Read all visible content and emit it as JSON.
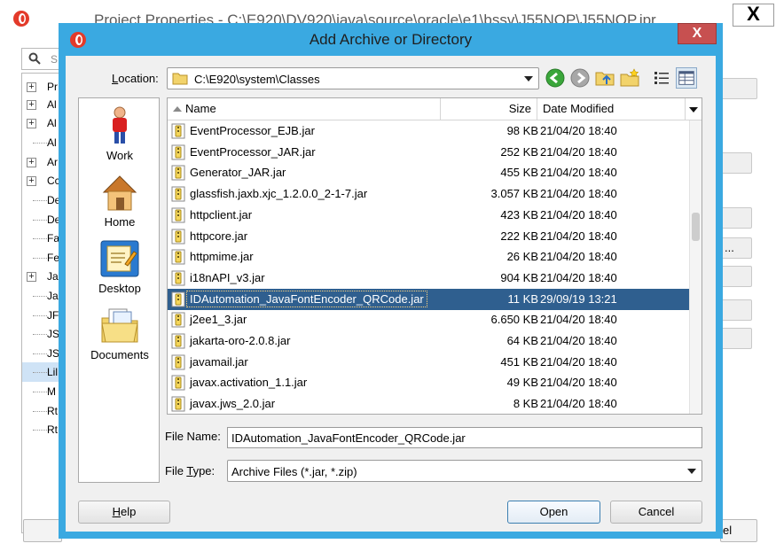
{
  "background_window": {
    "title": "Project Properties - C:\\E920\\DV920\\java\\source\\oracle\\e1\\bssv\\J55NOP\\J55NOP.jpr",
    "close_glyph": "X",
    "search_placeholder": "S",
    "tree_items": [
      "Pr",
      "Al",
      "Al",
      "Al",
      "Ar",
      "Cc",
      "De",
      "De",
      "Fa",
      "Fe",
      "Ja",
      "Ja",
      "JF",
      "JS",
      "JS",
      "Lil",
      "M",
      "Rt",
      "Rt"
    ],
    "browse_ellipsis": "...",
    "bottom_button_tail": "el"
  },
  "dialog": {
    "title": "Add Archive or Directory",
    "close_glyph": "X",
    "location": {
      "label_prefix": "L",
      "label_rest": "ocation:",
      "value": "C:\\E920\\system\\Classes"
    },
    "toolbar": {
      "back_icon": "back-icon",
      "forward_icon": "forward-icon",
      "up_folder_icon": "up-folder-icon",
      "new_folder_icon": "new-folder-icon",
      "list_view_icon": "list-view-icon",
      "details_view_icon": "details-view-icon"
    },
    "places": [
      {
        "label": "Work",
        "icon": "work-person-icon"
      },
      {
        "label": "Home",
        "icon": "home-icon"
      },
      {
        "label": "Desktop",
        "icon": "desktop-icon"
      },
      {
        "label": "Documents",
        "icon": "documents-icon"
      }
    ],
    "file_list": {
      "columns": [
        "Name",
        "Size",
        "Date Modified"
      ],
      "rows": [
        {
          "name": "EventProcessor_EJB.jar",
          "size": "98 KB",
          "date": "21/04/20 18:40"
        },
        {
          "name": "EventProcessor_JAR.jar",
          "size": "252 KB",
          "date": "21/04/20 18:40"
        },
        {
          "name": "Generator_JAR.jar",
          "size": "455 KB",
          "date": "21/04/20 18:40"
        },
        {
          "name": "glassfish.jaxb.xjc_1.2.0.0_2-1-7.jar",
          "size": "3.057 KB",
          "date": "21/04/20 18:40"
        },
        {
          "name": "httpclient.jar",
          "size": "423 KB",
          "date": "21/04/20 18:40"
        },
        {
          "name": "httpcore.jar",
          "size": "222 KB",
          "date": "21/04/20 18:40"
        },
        {
          "name": "httpmime.jar",
          "size": "26 KB",
          "date": "21/04/20 18:40"
        },
        {
          "name": "i18nAPI_v3.jar",
          "size": "904 KB",
          "date": "21/04/20 18:40"
        },
        {
          "name": "IDAutomation_JavaFontEncoder_QRCode.jar",
          "size": "11 KB",
          "date": "29/09/19 13:21",
          "selected": true
        },
        {
          "name": "j2ee1_3.jar",
          "size": "6.650 KB",
          "date": "21/04/20 18:40"
        },
        {
          "name": "jakarta-oro-2.0.8.jar",
          "size": "64 KB",
          "date": "21/04/20 18:40"
        },
        {
          "name": "javamail.jar",
          "size": "451 KB",
          "date": "21/04/20 18:40"
        },
        {
          "name": "javax.activation_1.1.jar",
          "size": "49 KB",
          "date": "21/04/20 18:40"
        },
        {
          "name": "javax.jws_2.0.jar",
          "size": "8 KB",
          "date": "21/04/20 18:40"
        }
      ]
    },
    "file_name": {
      "label": "File Name:",
      "value": "IDAutomation_JavaFontEncoder_QRCode.jar"
    },
    "file_type": {
      "label_prefix": "File ",
      "label_ul": "T",
      "label_rest": "ype:",
      "value": "Archive Files (*.jar, *.zip)"
    },
    "buttons": {
      "help_ul": "H",
      "help_rest": "elp",
      "open": "Open",
      "cancel": "Cancel"
    },
    "colors": {
      "frame": "#3aa9e1",
      "selection": "#2f5f8f",
      "close": "#c75050"
    }
  }
}
